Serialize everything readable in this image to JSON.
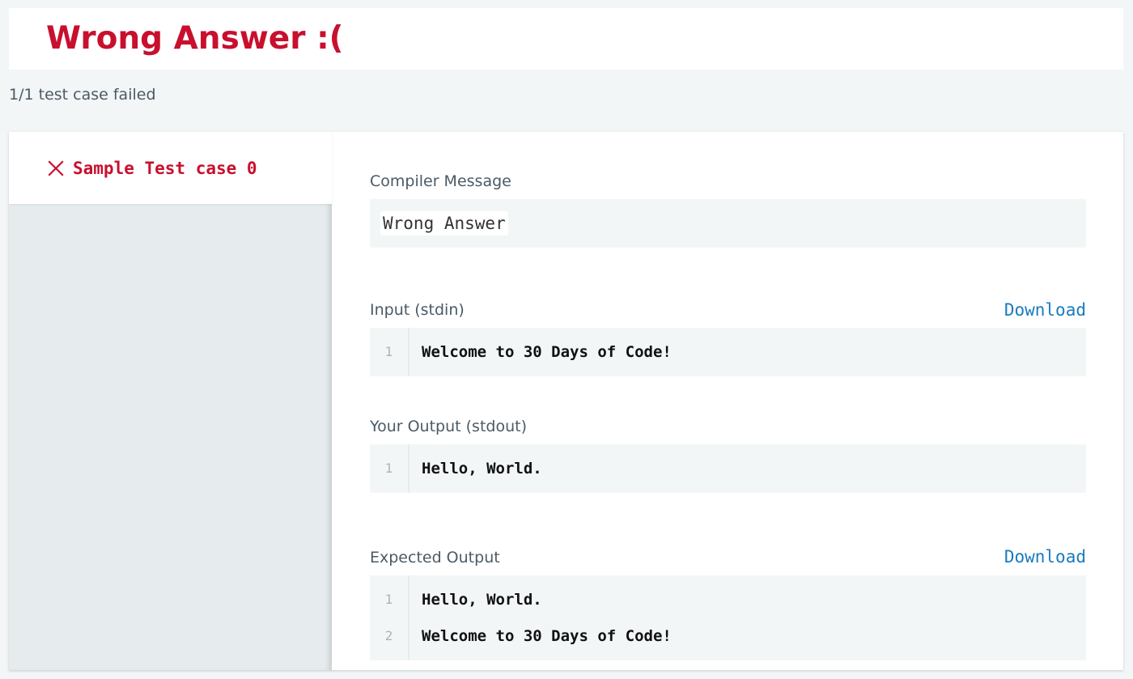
{
  "header": {
    "title": "Wrong Answer :("
  },
  "summary": "1/1 test case failed",
  "sidebar": {
    "test_cases": [
      {
        "label": "Sample Test case 0",
        "status": "failed",
        "icon": "x-icon"
      }
    ]
  },
  "main": {
    "compiler_message": {
      "label": "Compiler Message",
      "value": "Wrong Answer"
    },
    "input": {
      "label": "Input (stdin)",
      "download_label": "Download",
      "lines": [
        {
          "number": "1",
          "text": "Welcome to 30 Days of Code!"
        }
      ]
    },
    "your_output": {
      "label": "Your Output (stdout)",
      "lines": [
        {
          "number": "1",
          "text": "Hello, World."
        }
      ]
    },
    "expected_output": {
      "label": "Expected Output",
      "download_label": "Download",
      "lines": [
        {
          "number": "1",
          "text": "Hello, World."
        },
        {
          "number": "2",
          "text": "Welcome to 30 Days of Code!"
        }
      ]
    }
  },
  "colors": {
    "error_red": "#c8102e",
    "link_blue": "#1a7bbf",
    "page_background": "#f3f6f7",
    "code_background": "#f3f6f7",
    "sidebar_background": "#e6ecee"
  }
}
